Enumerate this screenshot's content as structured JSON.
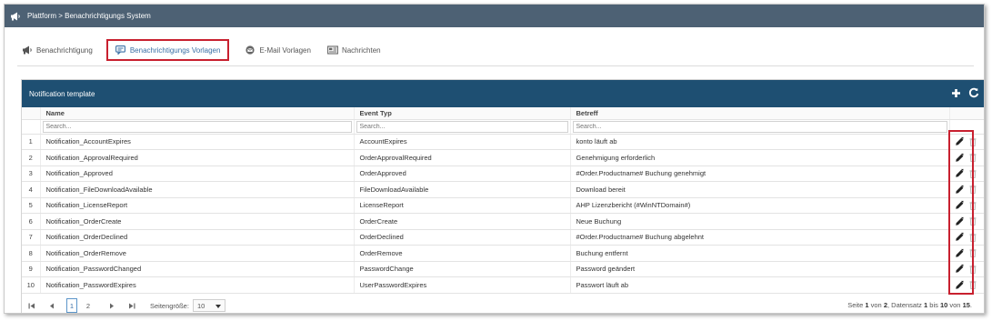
{
  "topbar": {
    "title": "Plattform > Benachrichtigungs System",
    "icon": "megaphone-icon"
  },
  "tabs": [
    {
      "label": "Benachrichtigung",
      "icon": "megaphone-icon",
      "active": false
    },
    {
      "label": "Benachrichtigungs Vorlagen",
      "icon": "message-icon",
      "active": true
    },
    {
      "label": "E-Mail Vorlagen",
      "icon": "at-icon",
      "active": false
    },
    {
      "label": "Nachrichten",
      "icon": "newspaper-icon",
      "active": false
    }
  ],
  "panel": {
    "title": "Notification template",
    "actions": {
      "add": "plus-icon",
      "refresh": "refresh-icon"
    }
  },
  "table": {
    "columns": [
      "Name",
      "Event Typ",
      "Betreff"
    ],
    "search_placeholder": "Search...",
    "rows": [
      {
        "num": "1",
        "name": "Notification_AccountExpires",
        "event": "AccountExpires",
        "betreff": "konto läuft ab"
      },
      {
        "num": "2",
        "name": "Notification_ApprovalRequired",
        "event": "OrderApprovalRequired",
        "betreff": "Genehmigung erforderlich"
      },
      {
        "num": "3",
        "name": "Notification_Approved",
        "event": "OrderApproved",
        "betreff": "#Order.Productname# Buchung genehmigt"
      },
      {
        "num": "4",
        "name": "Notification_FileDownloadAvailable",
        "event": "FileDownloadAvailable",
        "betreff": "Download bereit"
      },
      {
        "num": "5",
        "name": "Notification_LicenseReport",
        "event": "LicenseReport",
        "betreff": "AHP Lizenzbericht (#WinNTDomain#)"
      },
      {
        "num": "6",
        "name": "Notification_OrderCreate",
        "event": "OrderCreate",
        "betreff": "Neue Buchung"
      },
      {
        "num": "7",
        "name": "Notification_OrderDeclined",
        "event": "OrderDeclined",
        "betreff": "#Order.Productname# Buchung abgelehnt"
      },
      {
        "num": "8",
        "name": "Notification_OrderRemove",
        "event": "OrderRemove",
        "betreff": "Buchung entfernt"
      },
      {
        "num": "9",
        "name": "Notification_PasswordChanged",
        "event": "PasswordChange",
        "betreff": "Password geändert"
      },
      {
        "num": "10",
        "name": "Notification_PasswordExpires",
        "event": "UserPasswordExpires",
        "betreff": "Passwort läuft ab"
      }
    ],
    "row_actions": {
      "edit": "pencil-icon",
      "delete": "trash-icon"
    }
  },
  "pager": {
    "pages": [
      "1",
      "2"
    ],
    "current_page": "1",
    "page_size_label": "Seitengröße:",
    "page_size": "10",
    "info": {
      "p1": "Seite ",
      "page": "1",
      "p2": " von ",
      "pages": "2",
      "p3": ", Datensatz ",
      "from": "1",
      "p4": " bis ",
      "to": "10",
      "p5": " von ",
      "total": "15",
      "p6": "."
    }
  },
  "colors": {
    "topbar": "#4d6174",
    "panel_header": "#1e4f72",
    "highlight": "#c8202f",
    "active_tab_text": "#3a6fa5"
  }
}
